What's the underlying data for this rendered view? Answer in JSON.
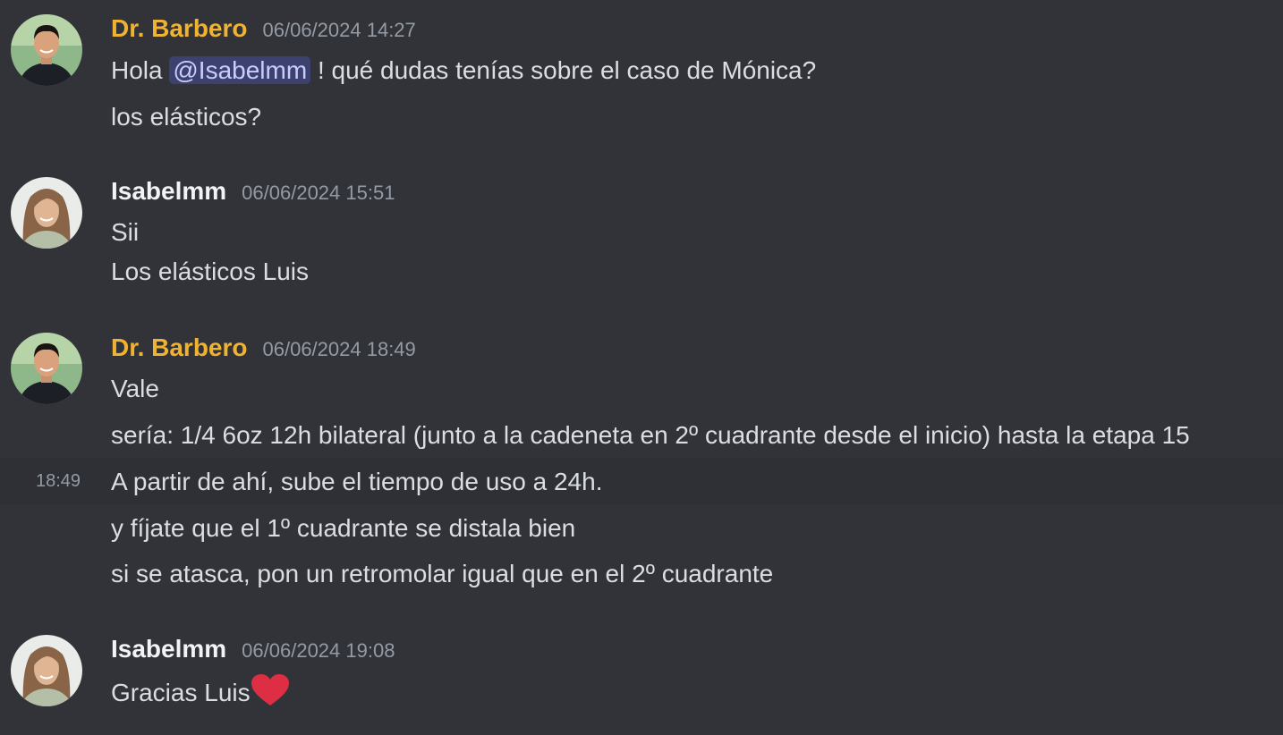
{
  "colors": {
    "background": "#313338",
    "doctor_name": "#f0b232",
    "isabel_name": "#f2f3f5",
    "mention_bg": "rgba(88,101,242,0.3)",
    "heart": "#dd2e44"
  },
  "messages": [
    {
      "author": "Dr. Barbero",
      "timestamp": "06/06/2024 14:27",
      "avatar": "doctor-avatar",
      "lines": [
        {
          "pre": "Hola ",
          "mention": "@Isabelmm",
          "post": " ! qué dudas tenías sobre el caso de Mónica?"
        },
        {
          "text": "los elásticos?"
        }
      ]
    },
    {
      "author": "Isabelmm",
      "timestamp": "06/06/2024 15:51",
      "avatar": "isabel-avatar",
      "lines": [
        {
          "text": "Sii"
        },
        {
          "text": "Los elásticos Luis"
        }
      ]
    },
    {
      "author": "Dr. Barbero",
      "timestamp": "06/06/2024 18:49",
      "avatar": "doctor-avatar",
      "lines": [
        {
          "text": "Vale"
        },
        {
          "text": "sería: 1/4 6oz 12h bilateral (junto a la cadeneta en 2º cuadrante desde el inicio) hasta la etapa 15"
        },
        {
          "text": "A partir de ahí, sube el tiempo de uso a 24h.",
          "hover_time": "18:49"
        },
        {
          "text": "y fíjate que el 1º cuadrante se distala bien"
        },
        {
          "text": "si se atasca, pon un retromolar igual que en el 2º cuadrante"
        }
      ]
    },
    {
      "author": "Isabelmm",
      "timestamp": "06/06/2024 19:08",
      "avatar": "isabel-avatar",
      "lines": [
        {
          "text": "Gracias Luis",
          "emoji": "heart-emoji"
        }
      ]
    }
  ]
}
